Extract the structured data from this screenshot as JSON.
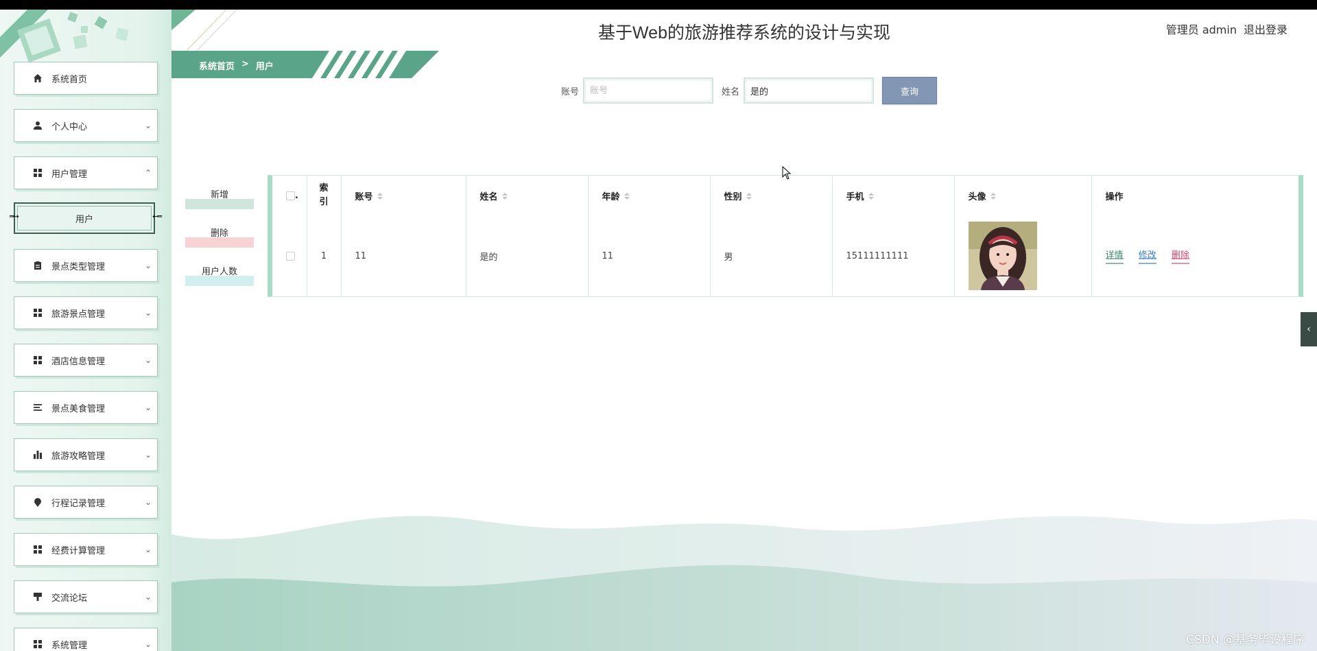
{
  "header": {
    "title": "基于Web的旅游推荐系统的设计与实现",
    "user_label": "管理员 admin",
    "logout_label": "退出登录"
  },
  "breadcrumb": {
    "home": "系统首页",
    "separator": ">",
    "current": "用户"
  },
  "sidebar": {
    "items": [
      {
        "label": "系统首页",
        "icon": "home-icon",
        "arrow": ""
      },
      {
        "label": "个人中心",
        "icon": "person-icon",
        "arrow": "⌄"
      },
      {
        "label": "用户管理",
        "icon": "grid-icon",
        "arrow": "⌃"
      },
      {
        "label": "景点类型管理",
        "icon": "clipboard-icon",
        "arrow": "⌄"
      },
      {
        "label": "旅游景点管理",
        "icon": "grid-icon",
        "arrow": "⌄"
      },
      {
        "label": "酒店信息管理",
        "icon": "grid-icon",
        "arrow": "⌄"
      },
      {
        "label": "景点美食管理",
        "icon": "list-icon",
        "arrow": "⌄"
      },
      {
        "label": "旅游攻略管理",
        "icon": "bar-chart-icon",
        "arrow": "⌄"
      },
      {
        "label": "行程记录管理",
        "icon": "pin-icon",
        "arrow": "⌄"
      },
      {
        "label": "经费计算管理",
        "icon": "grid-icon",
        "arrow": "⌄"
      },
      {
        "label": "交流论坛",
        "icon": "brush-icon",
        "arrow": "⌄"
      },
      {
        "label": "系统管理",
        "icon": "grid-icon",
        "arrow": "⌄"
      }
    ],
    "sub_item": "用户"
  },
  "search": {
    "account_label": "账号",
    "account_placeholder": "账号",
    "account_value": "",
    "name_label": "姓名",
    "name_value": "是的",
    "query_button": "查询"
  },
  "actions": {
    "add": "新增",
    "delete": "删除",
    "user_count": "用户人数"
  },
  "table": {
    "headers": {
      "checkbox": ".",
      "index": "索引",
      "account": "账号",
      "name": "姓名",
      "age": "年龄",
      "gender": "性别",
      "phone": "手机",
      "avatar": "头像",
      "ops": "操作"
    },
    "rows": [
      {
        "index": "1",
        "account": "11",
        "name": "是的",
        "age": "11",
        "gender": "男",
        "phone": "15111111111"
      }
    ],
    "ops": {
      "detail": "详情",
      "edit": "修改",
      "delete": "删除"
    }
  },
  "colors": {
    "accent": "#5aa58a",
    "query_button": "#8297b3",
    "add_band": "#cfe6dc",
    "delete_band": "#f8d3d6",
    "count_band": "#d1eef0",
    "detail": "#3e8c6e",
    "edit": "#3b7ac7",
    "delete": "#d9476a"
  },
  "watermark": "CSDN @基务毕设程序"
}
